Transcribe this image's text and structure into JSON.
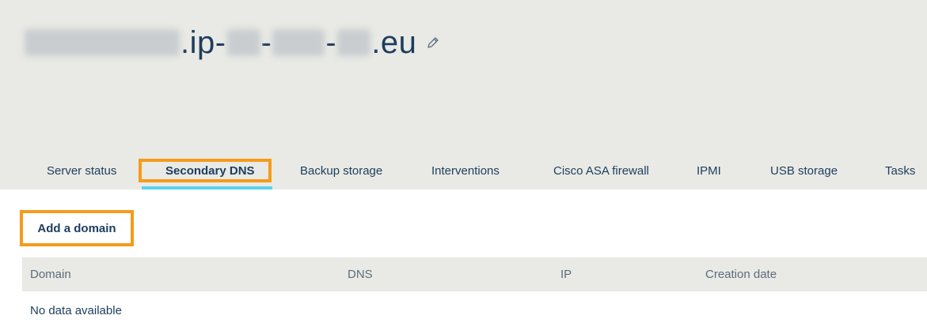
{
  "header": {
    "title_segments": [
      ".ip-",
      "-",
      "-",
      ".eu"
    ],
    "edit_icon": "pencil-icon"
  },
  "tabs": [
    {
      "label": "Server status",
      "active": false
    },
    {
      "label": "Secondary DNS",
      "active": true
    },
    {
      "label": "Backup storage",
      "active": false
    },
    {
      "label": "Interventions",
      "active": false
    },
    {
      "label": "Cisco ASA firewall",
      "active": false
    },
    {
      "label": "IPMI",
      "active": false
    },
    {
      "label": "USB storage",
      "active": false
    },
    {
      "label": "Tasks",
      "active": false
    }
  ],
  "actions": {
    "add_domain_label": "Add a domain"
  },
  "table": {
    "columns": [
      "Domain",
      "DNS",
      "IP",
      "Creation date"
    ],
    "empty_message": "No data available"
  },
  "colors": {
    "highlight": "#f59b1b",
    "active_underline": "#59d2ef",
    "header_bg": "#e9eae5",
    "text": "#1d3d5e"
  }
}
